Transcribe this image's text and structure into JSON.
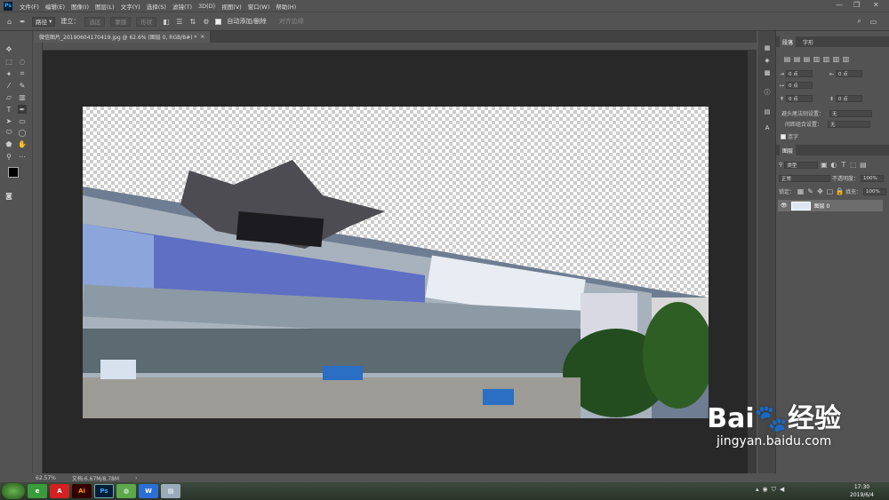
{
  "app": {
    "logo": "Ps"
  },
  "menu": [
    "文件(F)",
    "编辑(E)",
    "图像(I)",
    "图层(L)",
    "文字(Y)",
    "选择(S)",
    "滤镜(T)",
    "3D(D)",
    "视图(V)",
    "窗口(W)",
    "帮助(H)"
  ],
  "options": {
    "mode_select": "路径",
    "make_label": "建立：",
    "selection_btn": "选区",
    "mask_btn": "蒙版",
    "shape_btn": "形状",
    "auto_add_label": "自动添加/删除",
    "align_edges_label": "对齐边缘"
  },
  "document_tab": "微信图片_20190604170419.jpg @ 62.6% (图层 0, RGB/8#) *",
  "status": {
    "zoom": "62.57%",
    "doc": "文档:6.67M/8.78M"
  },
  "character_panel": {
    "tabs": [
      "段落",
      "字形"
    ],
    "indent_values": [
      "0 点",
      "0 点",
      "0 点",
      "0 点",
      "0 点"
    ],
    "rule_label": "避头尾法则设置：",
    "rule_value": "无",
    "spacing_label": "间距组合设置：",
    "spacing_value": "无",
    "hyphen_label": "连字"
  },
  "layers_panel": {
    "title": "图层",
    "filter_kind": "类型",
    "blend_mode": "正常",
    "opacity_label": "不透明度：",
    "opacity_value": "100%",
    "lock_label": "锁定：",
    "fill_label": "填充：",
    "fill_value": "100%",
    "layer_name": "图层 0"
  },
  "taskbar": {
    "time": "17:30",
    "date": "2019/6/4"
  },
  "watermark": {
    "line1": "Bai🐾经验",
    "line2": "jingyan.baidu.com"
  }
}
